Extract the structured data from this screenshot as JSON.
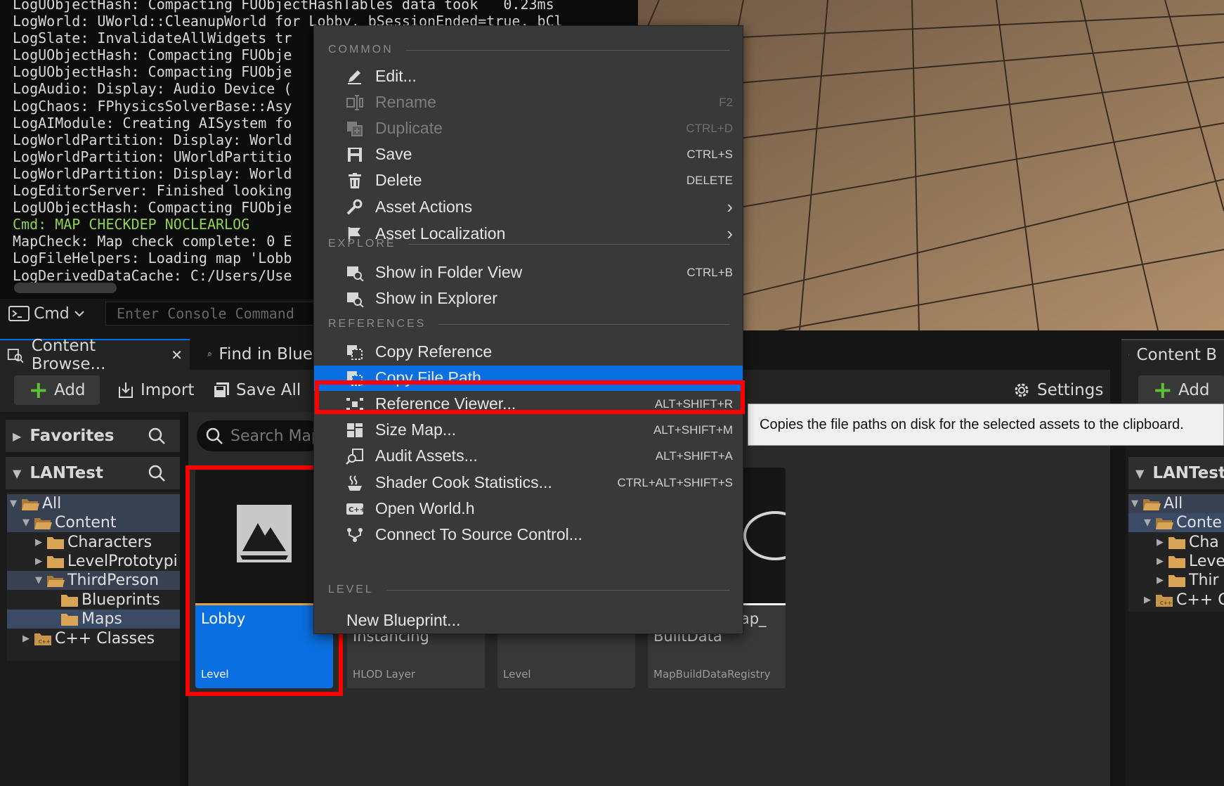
{
  "console": {
    "lines": [
      "LogUObjectHash: Compacting FUObjectHashTables data took   0.23ms",
      "LogWorld: UWorld::CleanupWorld for Lobby, bSessionEnded=true, bCl",
      "LogSlate: InvalidateAllWidgets tr",
      "LogUObjectHash: Compacting FUObje",
      "LogUObjectHash: Compacting FUObje",
      "LogAudio: Display: Audio Device (",
      "LogChaos: FPhysicsSolverBase::Asy",
      "LogAIModule: Creating AISystem fo",
      "LogWorldPartition: Display: World",
      "LogWorldPartition: UWorldPartitio",
      "LogWorldPartition: Display: World",
      "LogEditorServer: Finished looking",
      "LogUObjectHash: Compacting FUObje",
      "Cmd: MAP CHECKDEP NOCLEARLOG",
      "MapCheck: Map check complete: 0 E",
      "LogFileHelpers: Loading map 'Lobb",
      "LogDerivedDataCache: C:/Users/Use"
    ],
    "cmd_label": "Cmd",
    "input_placeholder": "Enter Console Command"
  },
  "tabs": {
    "content_browser": "Content Browse...",
    "find_in_blueprints": "Find in Blue",
    "content_browser_2": "Content B"
  },
  "toolbar": {
    "add": "Add",
    "import": "Import",
    "save_all": "Save All",
    "settings": "Settings"
  },
  "tree": {
    "favorites": "Favorites",
    "project": "LANTest",
    "nodes": [
      "All",
      "Content",
      "Characters",
      "LevelPrototypi",
      "ThirdPerson",
      "Blueprints",
      "Maps",
      "C++ Classes"
    ]
  },
  "right_tree": {
    "project": "LANTest",
    "nodes": [
      "All",
      "Conte",
      "Cha",
      "Leve",
      "Thir",
      "C++ C"
    ]
  },
  "search": {
    "placeholder": "Search Map"
  },
  "assets": [
    {
      "name": "Lobby",
      "type": "Level"
    },
    {
      "name": "Instancing",
      "type": "HLOD Layer"
    },
    {
      "name": "",
      "type": "Level"
    },
    {
      "name": "BuiltData",
      "name_prefix": "lap_",
      "type": "MapBuildDataRegistry"
    }
  ],
  "menu": {
    "sections": {
      "common": "COMMON",
      "explore": "EXPLORE",
      "references": "REFERENCES",
      "level": "LEVEL"
    },
    "items": {
      "edit": {
        "label": "Edit...",
        "shortcut": ""
      },
      "rename": {
        "label": "Rename",
        "shortcut": "F2"
      },
      "duplicate": {
        "label": "Duplicate",
        "shortcut": "CTRL+D"
      },
      "save": {
        "label": "Save",
        "shortcut": "CTRL+S"
      },
      "delete": {
        "label": "Delete",
        "shortcut": "DELETE"
      },
      "asset_actions": {
        "label": "Asset Actions"
      },
      "asset_localization": {
        "label": "Asset Localization"
      },
      "show_folder_view": {
        "label": "Show in Folder View",
        "shortcut": "CTRL+B"
      },
      "show_explorer": {
        "label": "Show in Explorer"
      },
      "copy_reference": {
        "label": "Copy Reference"
      },
      "copy_file_path": {
        "label": "Copy File Path"
      },
      "reference_viewer": {
        "label": "Reference Viewer...",
        "shortcut": "ALT+SHIFT+R"
      },
      "size_map": {
        "label": "Size Map...",
        "shortcut": "ALT+SHIFT+M"
      },
      "audit_assets": {
        "label": "Audit Assets...",
        "shortcut": "ALT+SHIFT+A"
      },
      "shader_cook": {
        "label": "Shader Cook Statistics...",
        "shortcut": "CTRL+ALT+SHIFT+S"
      },
      "open_world_h": {
        "label": "Open World.h"
      },
      "connect_source": {
        "label": "Connect To Source Control..."
      },
      "new_blueprint": {
        "label": "New Blueprint..."
      }
    }
  },
  "tooltip": "Copies the file paths on disk for the selected assets to the clipboard.",
  "colors": {
    "selection_blue": "#0a6fe0",
    "highlight_red": "#ff0000",
    "cmd_green": "#8fd34f",
    "add_green": "#5bc234",
    "folder_tan": "#c8954a"
  }
}
